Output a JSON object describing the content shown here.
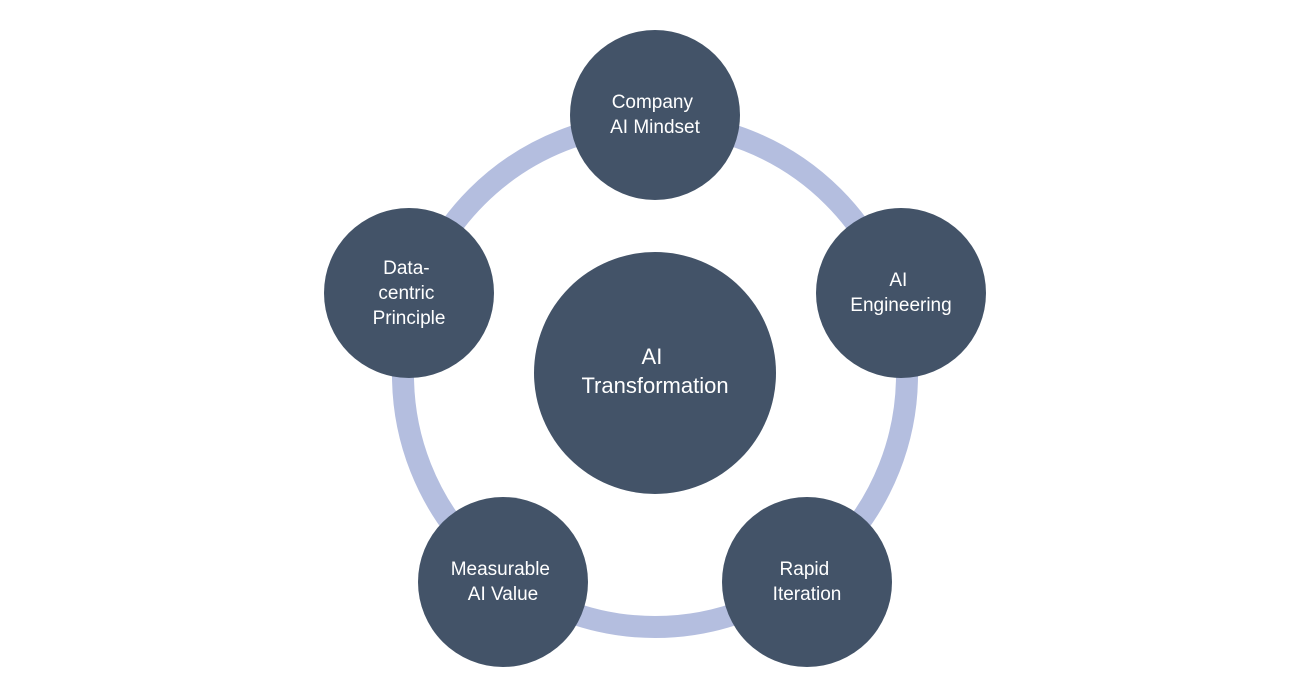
{
  "diagram": {
    "center": {
      "lines": [
        "AI",
        "Transformation"
      ]
    },
    "nodes": [
      {
        "lines": [
          "Company",
          "AI Mindset"
        ]
      },
      {
        "lines": [
          "AI",
          "Engineering"
        ]
      },
      {
        "lines": [
          "Rapid",
          "Iteration"
        ]
      },
      {
        "lines": [
          "Measurable",
          "AI Value"
        ]
      },
      {
        "lines": [
          "Data-",
          "centric",
          "Principle"
        ]
      }
    ],
    "colors": {
      "node_fill": "#435368",
      "ring": "#b4bedf",
      "text": "#ffffff",
      "background": "#ffffff"
    }
  }
}
